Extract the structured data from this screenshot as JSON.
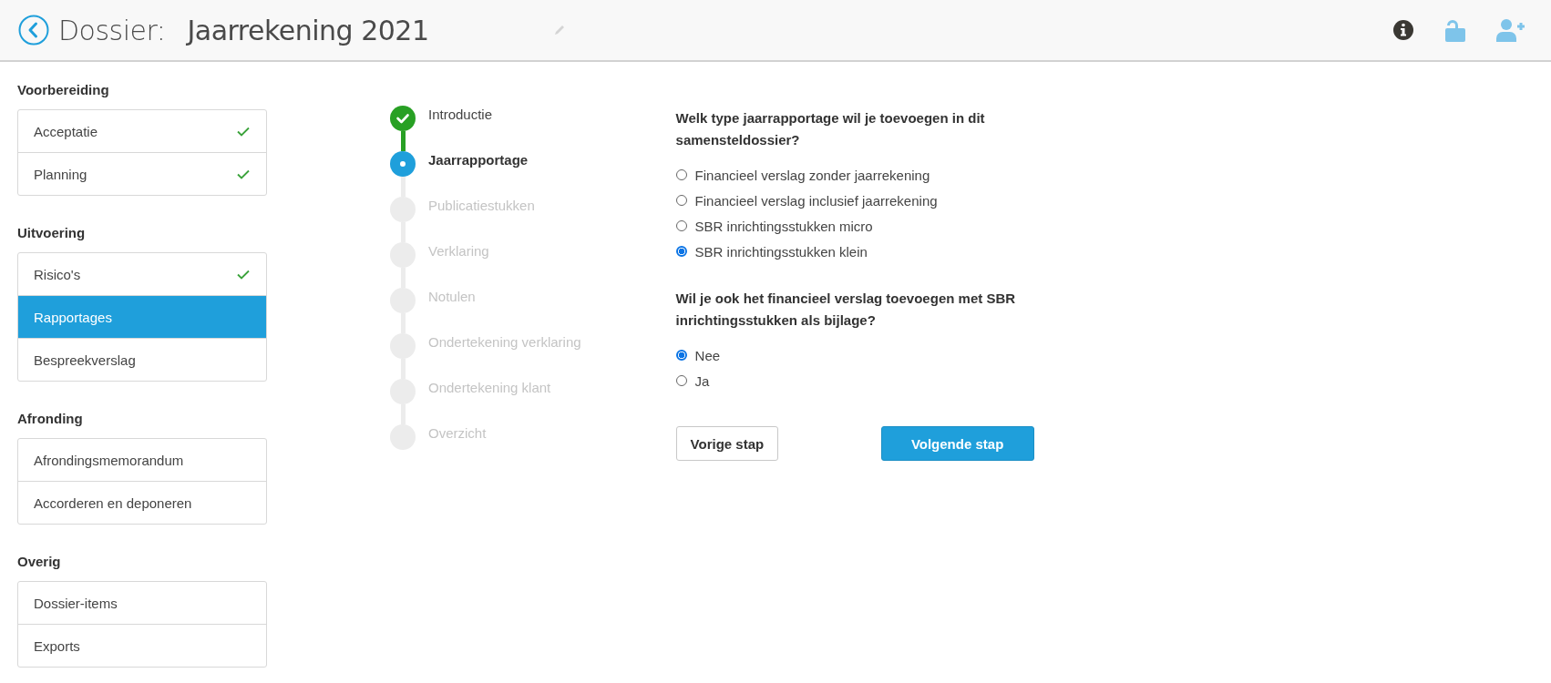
{
  "header": {
    "label": "Dossier:",
    "title": "Jaarrekening 2021"
  },
  "sidebar": {
    "sections": [
      {
        "title": "Voorbereiding",
        "items": [
          {
            "label": "Acceptatie",
            "checked": true,
            "selected": false
          },
          {
            "label": "Planning",
            "checked": true,
            "selected": false
          }
        ]
      },
      {
        "title": "Uitvoering",
        "items": [
          {
            "label": "Risico's",
            "checked": true,
            "selected": false
          },
          {
            "label": "Rapportages",
            "checked": false,
            "selected": true
          },
          {
            "label": "Bespreekverslag",
            "checked": false,
            "selected": false
          }
        ]
      },
      {
        "title": "Afronding",
        "items": [
          {
            "label": "Afrondingsmemorandum",
            "checked": false,
            "selected": false
          },
          {
            "label": "Accorderen en deponeren",
            "checked": false,
            "selected": false
          }
        ]
      },
      {
        "title": "Overig",
        "items": [
          {
            "label": "Dossier-items",
            "checked": false,
            "selected": false
          },
          {
            "label": "Exports",
            "checked": false,
            "selected": false
          }
        ]
      }
    ]
  },
  "steps": [
    {
      "label": "Introductie",
      "completed": true,
      "selected": false
    },
    {
      "label": "Jaarrapportage",
      "completed": false,
      "selected": true
    },
    {
      "label": "Publicatiestukken",
      "completed": false,
      "selected": false
    },
    {
      "label": "Verklaring",
      "completed": false,
      "selected": false
    },
    {
      "label": "Notulen",
      "completed": false,
      "selected": false
    },
    {
      "label": "Ondertekening verklaring",
      "completed": false,
      "selected": false
    },
    {
      "label": "Ondertekening klant",
      "completed": false,
      "selected": false
    },
    {
      "label": "Overzicht",
      "completed": false,
      "selected": false
    }
  ],
  "questions": [
    {
      "text": "Welk type jaarrapportage wil je toevoegen in dit samensteldossier?",
      "options": [
        {
          "label": "Financieel verslag zonder jaarrekening",
          "selected": false
        },
        {
          "label": "Financieel verslag inclusief jaarrekening",
          "selected": false
        },
        {
          "label": "SBR inrichtingsstukken micro",
          "selected": false
        },
        {
          "label": "SBR inrichtingsstukken klein",
          "selected": true
        }
      ]
    },
    {
      "text": "Wil je ook het financieel verslag toevoegen met SBR inrichtingsstukken als bijlage?",
      "options": [
        {
          "label": "Nee",
          "selected": true
        },
        {
          "label": "Ja",
          "selected": false
        }
      ]
    }
  ],
  "buttons": {
    "previous": "Vorige stap",
    "next": "Volgende stap"
  }
}
